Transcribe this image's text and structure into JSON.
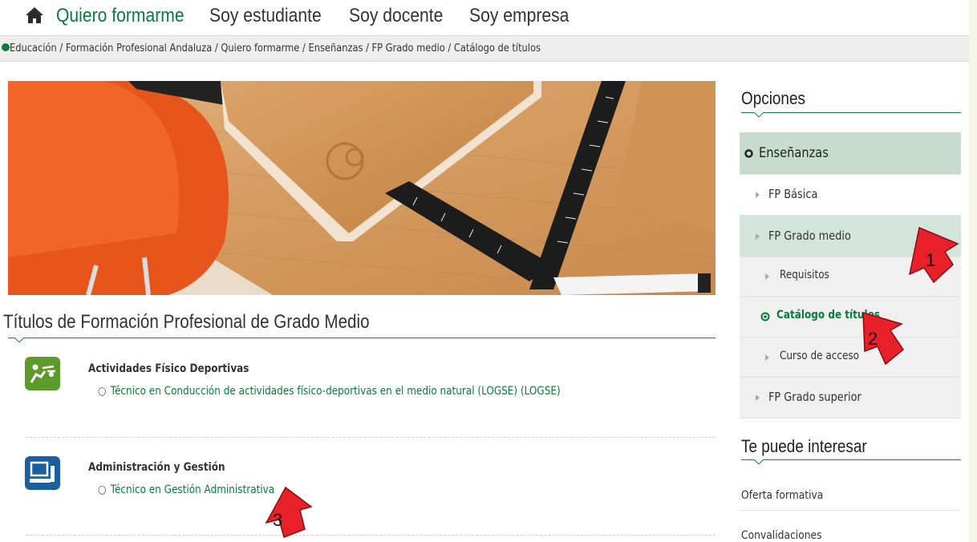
{
  "nav": {
    "items": [
      "Quiero formarme",
      "Soy estudiante",
      "Soy docente",
      "Soy empresa"
    ]
  },
  "breadcrumb": {
    "text": "Educación  /  Formación Profesional Andaluza  /  Quiero formarme  /  Enseñanzas  /  FP Grado medio  /  Catálogo de títulos"
  },
  "main": {
    "title": "Títulos de Formación Profesional de Grado Medio",
    "families": [
      {
        "name": "Actividades Físico Deportivas",
        "titles": [
          "Técnico en Conducción de actividades físico-deportivas en el medio natural (LOGSE) (LOGSE)"
        ]
      },
      {
        "name": "Administración y Gestión",
        "titles": [
          "Técnico en Gestión Administrativa"
        ]
      }
    ]
  },
  "sidebar": {
    "options_title": "Opciones",
    "menu": {
      "section": "Enseñanzas",
      "fp_basica": "FP Básica",
      "fp_grado_medio": "FP Grado medio",
      "requisitos": "Requisitos",
      "catalogo": "Catálogo de títulos",
      "curso_acceso": "Curso de acceso",
      "fp_grado_superior": "FP Grado superior"
    },
    "interest_title": "Te puede interesar",
    "interest_links": [
      "Oferta formativa",
      "Convalidaciones"
    ]
  },
  "annotations": [
    "1",
    "2",
    "3"
  ],
  "colors": {
    "accent": "#0a7a3c",
    "sidebar_active": "#d4e5dc",
    "sidebar_section": "#c7dccf",
    "arrow": "#e8202a"
  }
}
